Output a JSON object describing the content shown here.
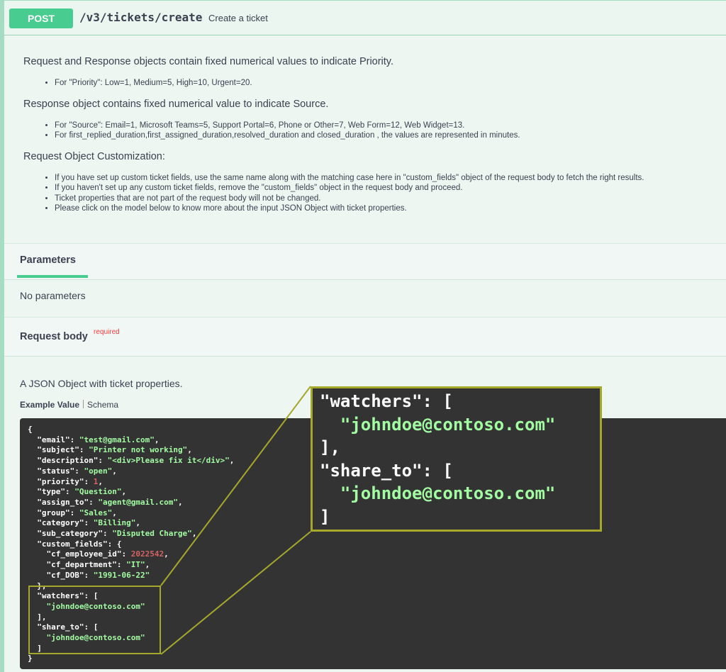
{
  "operation": {
    "method": "POST",
    "path": "/v3/tickets/create",
    "summary": "Create a ticket"
  },
  "description": {
    "sections": [
      {
        "heading": "Request and Response objects contain fixed numerical values to indicate Priority.",
        "bullets": [
          "For \"Priority\": Low=1, Medium=5, High=10, Urgent=20."
        ]
      },
      {
        "heading": "Response object contains fixed numerical value to indicate Source.",
        "bullets": [
          "For \"Source\": Email=1, Microsoft Teams=5, Support Portal=6, Phone or Other=7, Web Form=12, Web Widget=13.",
          "For first_replied_duration,first_assigned_duration,resolved_duration and closed_duration , the values are represented in minutes."
        ]
      },
      {
        "heading": "Request Object Customization:",
        "bullets": [
          "If you have set up custom ticket fields, use the same name along with the matching case here in \"custom_fields\" object of the request body to fetch the right results.",
          "If you haven't set up any custom ticket fields, remove the \"custom_fields\" object in the request body and proceed.",
          "Ticket properties that are not part of the request body will not be changed.",
          "Please click on the model below to know more about the input JSON Object with ticket properties."
        ]
      }
    ]
  },
  "parameters": {
    "tab_label": "Parameters",
    "empty_text": "No parameters"
  },
  "request_body": {
    "title": "Request body",
    "required_label": "required",
    "description": "A JSON Object with ticket properties.",
    "tabs": {
      "example": "Example Value",
      "schema": "Schema"
    }
  },
  "example_json": [
    "{",
    "  \"email\": \"test@gmail.com\",",
    "  \"subject\": \"Printer not working\",",
    "  \"description\": \"<div>Please fix it</div>\",",
    "  \"status\": \"open\",",
    "  \"priority\": 1,",
    "  \"type\": \"Question\",",
    "  \"assign_to\": \"agent@gmail.com\",",
    "  \"group\": \"Sales\",",
    "  \"category\": \"Billing\",",
    "  \"sub_category\": \"Disputed Charge\",",
    "  \"custom_fields\": {",
    "    \"cf_employee_id\": 2022542,",
    "    \"cf_department\": \"IT\",",
    "    \"cf_DOB\": \"1991-06-22\"",
    "  },",
    "  \"watchers\": [",
    "    \"johndoe@contoso.com\"",
    "  ],",
    "  \"share_to\": [",
    "    \"johndoe@contoso.com\"",
    "  ]",
    "}"
  ],
  "zoom_json": [
    "\"watchers\": [",
    "  \"johndoe@contoso.com\"",
    "],",
    "\"share_to\": [",
    "  \"johndoe@contoso.com\"",
    "]"
  ],
  "colors": {
    "method_post": "#49cc90",
    "code_background": "#333333",
    "json_string": "#a2fca2",
    "json_number": "#d36363",
    "highlight_border": "#a5a82a",
    "required": "#f93e3e"
  }
}
